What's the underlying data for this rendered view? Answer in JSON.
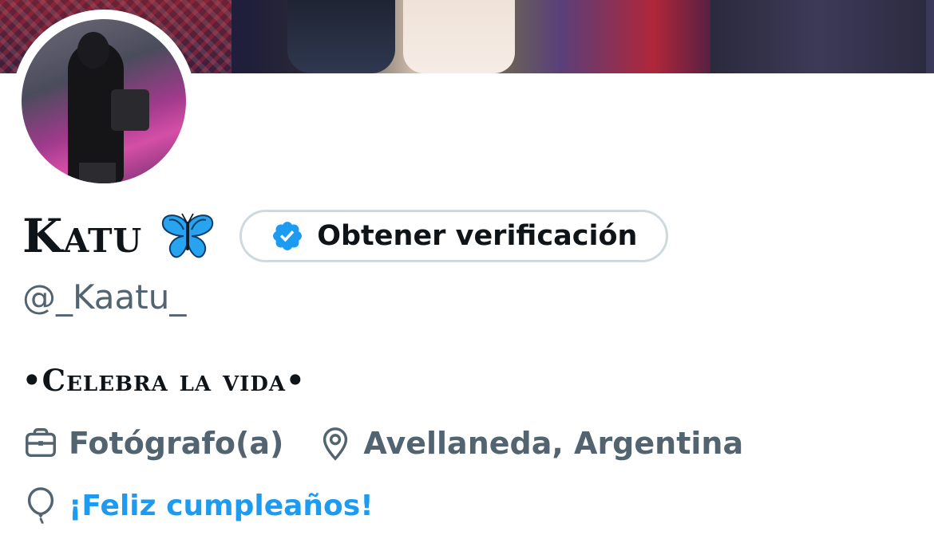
{
  "profile": {
    "display_name": "Katu",
    "handle": "@_Kaatu_",
    "bio": "•Celebra la vida•",
    "verify_button_label": "Obtener verificación",
    "profession": "Fotógrafo(a)",
    "location": "Avellaneda, Argentina",
    "birthday_text": "¡Feliz cumpleaños!"
  },
  "icons": {
    "name_emoji": "butterfly-icon",
    "verify": "verified-badge-icon",
    "profession": "briefcase-icon",
    "location": "location-pin-icon",
    "birthday": "balloon-icon"
  },
  "colors": {
    "accent": "#1d9bf0",
    "text_primary": "#0f1419",
    "text_secondary": "#536471",
    "button_border": "#cfd9de"
  }
}
